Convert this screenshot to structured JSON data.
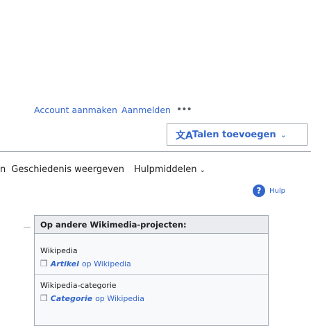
{
  "personal": {
    "create_account": "Account aanmaken",
    "login": "Aanmelden",
    "more": "•••"
  },
  "language": {
    "icon": "translate-icon",
    "label": "Talen toevoegen",
    "chevron": "⌄"
  },
  "tabs": {
    "partial_read": "n",
    "history": "Geschiedenis weergeven",
    "tools": "Hulpmiddelen",
    "chevron": "⌄"
  },
  "help": {
    "icon": "help-icon",
    "label": "Hulp"
  },
  "other_projects": {
    "header": "Op andere Wikimedia-projecten:",
    "items": [
      {
        "project": "Wikipedia",
        "link_bold": "Artikel",
        "link_rest": "op Wikipedia"
      },
      {
        "project": "Wikipedia-categorie",
        "link_bold": "Categorie",
        "link_rest": "op Wikipedia"
      }
    ]
  },
  "colors": {
    "link": "#3366cc",
    "text": "#202122",
    "border": "#a2a9b1",
    "box_bg": "#f8f9fa"
  }
}
